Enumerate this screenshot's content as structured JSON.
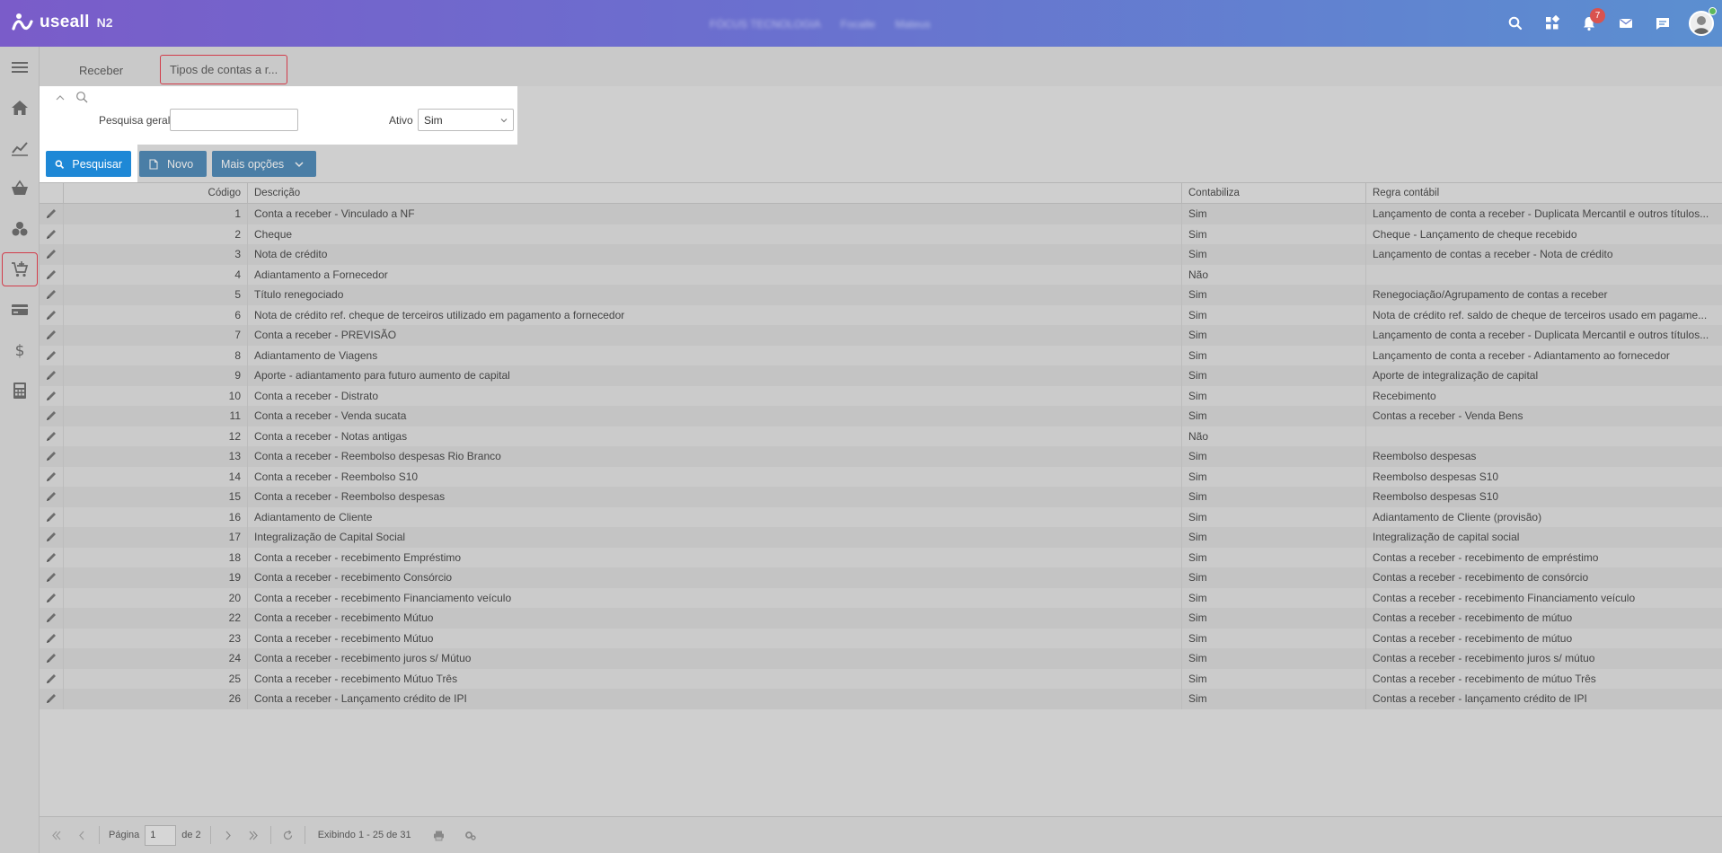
{
  "app": {
    "logo_text": "useall",
    "logo_sub": "N2",
    "header_center": [
      "FÓCUS TECNOLOGIA",
      "Focalle",
      "Mateus"
    ],
    "notification_count": "7"
  },
  "tabs": [
    {
      "label": "Receber"
    },
    {
      "label": "Tipos de contas a r..."
    }
  ],
  "search": {
    "general_label": "Pesquisa geral",
    "general_value": "",
    "ativo_label": "Ativo",
    "ativo_value": "Sim"
  },
  "toolbar": {
    "pesquisar": "Pesquisar",
    "novo": "Novo",
    "mais_opcoes": "Mais opções"
  },
  "grid": {
    "headers": {
      "codigo": "Código",
      "descricao": "Descrição",
      "contabiliza": "Contabiliza",
      "regra": "Regra contábil"
    },
    "rows": [
      {
        "codigo": "1",
        "descricao": "Conta a receber - Vinculado a NF",
        "contabiliza": "Sim",
        "regra": "Lançamento de conta a receber - Duplicata Mercantil e outros títulos..."
      },
      {
        "codigo": "2",
        "descricao": "Cheque",
        "contabiliza": "Sim",
        "regra": "Cheque - Lançamento de cheque recebido"
      },
      {
        "codigo": "3",
        "descricao": "Nota de crédito",
        "contabiliza": "Sim",
        "regra": "Lançamento de contas a receber - Nota de crédito"
      },
      {
        "codigo": "4",
        "descricao": "Adiantamento a Fornecedor",
        "contabiliza": "Não",
        "regra": ""
      },
      {
        "codigo": "5",
        "descricao": "Título renegociado",
        "contabiliza": "Sim",
        "regra": "Renegociação/Agrupamento de contas a receber"
      },
      {
        "codigo": "6",
        "descricao": "Nota de crédito ref. cheque de terceiros utilizado em pagamento a fornecedor",
        "contabiliza": "Sim",
        "regra": "Nota de crédito ref. saldo de cheque de terceiros usado em pagame..."
      },
      {
        "codigo": "7",
        "descricao": "Conta a receber - PREVISÃO",
        "contabiliza": "Sim",
        "regra": "Lançamento de conta a receber - Duplicata Mercantil e outros títulos..."
      },
      {
        "codigo": "8",
        "descricao": "Adiantamento de Viagens",
        "contabiliza": "Sim",
        "regra": "Lançamento de conta a receber - Adiantamento ao fornecedor"
      },
      {
        "codigo": "9",
        "descricao": "Aporte - adiantamento para futuro aumento de capital",
        "contabiliza": "Sim",
        "regra": "Aporte de integralização de capital"
      },
      {
        "codigo": "10",
        "descricao": "Conta a receber - Distrato",
        "contabiliza": "Sim",
        "regra": "Recebimento"
      },
      {
        "codigo": "11",
        "descricao": "Conta a receber - Venda sucata",
        "contabiliza": "Sim",
        "regra": "Contas a receber - Venda Bens"
      },
      {
        "codigo": "12",
        "descricao": "Conta a receber - Notas antigas",
        "contabiliza": "Não",
        "regra": ""
      },
      {
        "codigo": "13",
        "descricao": "Conta a receber - Reembolso despesas Rio Branco",
        "contabiliza": "Sim",
        "regra": "Reembolso despesas"
      },
      {
        "codigo": "14",
        "descricao": "Conta a receber - Reembolso S10",
        "contabiliza": "Sim",
        "regra": "Reembolso despesas S10"
      },
      {
        "codigo": "15",
        "descricao": "Conta a receber - Reembolso despesas",
        "contabiliza": "Sim",
        "regra": "Reembolso despesas S10"
      },
      {
        "codigo": "16",
        "descricao": "Adiantamento de Cliente",
        "contabiliza": "Sim",
        "regra": "Adiantamento de Cliente (provisão)"
      },
      {
        "codigo": "17",
        "descricao": "Integralização de Capital Social",
        "contabiliza": "Sim",
        "regra": "Integralização de capital social"
      },
      {
        "codigo": "18",
        "descricao": "Conta a receber - recebimento Empréstimo",
        "contabiliza": "Sim",
        "regra": "Contas a receber - recebimento de empréstimo"
      },
      {
        "codigo": "19",
        "descricao": "Conta a receber - recebimento Consórcio",
        "contabiliza": "Sim",
        "regra": "Contas a receber - recebimento de consórcio"
      },
      {
        "codigo": "20",
        "descricao": "Conta a receber - recebimento Financiamento veículo",
        "contabiliza": "Sim",
        "regra": "Contas a receber - recebimento Financiamento veículo"
      },
      {
        "codigo": "22",
        "descricao": "Conta a receber - recebimento Mútuo",
        "contabiliza": "Sim",
        "regra": "Contas a receber - recebimento de mútuo"
      },
      {
        "codigo": "23",
        "descricao": "Conta a receber - recebimento Mútuo",
        "contabiliza": "Sim",
        "regra": "Contas a receber - recebimento de mútuo"
      },
      {
        "codigo": "24",
        "descricao": "Conta a receber - recebimento juros s/ Mútuo",
        "contabiliza": "Sim",
        "regra": "Contas a receber - recebimento juros s/ mútuo"
      },
      {
        "codigo": "25",
        "descricao": "Conta a receber - recebimento Mútuo Três",
        "contabiliza": "Sim",
        "regra": "Contas a receber - recebimento de mútuo Três"
      },
      {
        "codigo": "26",
        "descricao": "Conta a receber - Lançamento crédito de IPI",
        "contabiliza": "Sim",
        "regra": "Contas a receber - lançamento crédito de IPI"
      }
    ]
  },
  "pager": {
    "page_label": "Página",
    "page_value": "1",
    "of_label": "de 2",
    "display_text": "Exibindo 1 - 25 de 31"
  },
  "colors": {
    "header_start": "#7a5cc9",
    "header_end": "#5b8fd0",
    "primary_button": "#1e88d6",
    "secondary_button": "#4a7ea6",
    "active_border": "#d23c4a"
  }
}
